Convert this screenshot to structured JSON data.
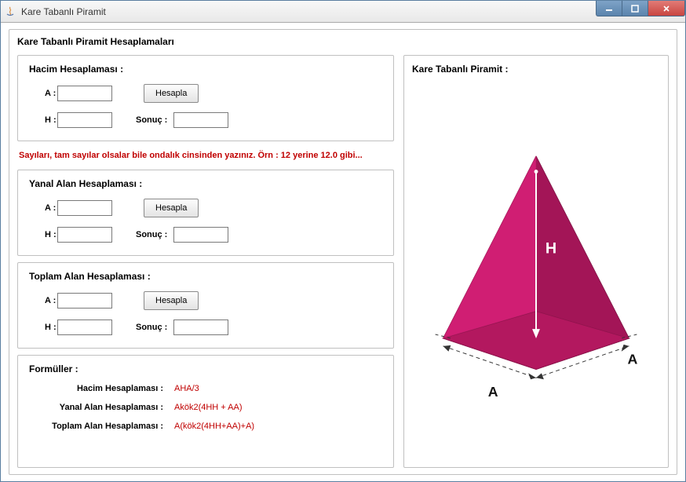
{
  "window": {
    "title": "Kare Tabanlı Piramit"
  },
  "main": {
    "header": "Kare Tabanlı Piramit Hesaplamaları"
  },
  "hacim": {
    "title": "Hacim Hesaplaması :",
    "a_label": "A :",
    "h_label": "H :",
    "button": "Hesapla",
    "sonuc_label": "Sonuç :",
    "a_value": "",
    "h_value": "",
    "sonuc_value": ""
  },
  "warning": "Sayıları, tam sayılar olsalar bile ondalık cinsinden yazınız. Örn : 12 yerine 12.0 gibi...",
  "yanal": {
    "title": "Yanal Alan Hesaplaması :",
    "a_label": "A :",
    "h_label": "H :",
    "button": "Hesapla",
    "sonuc_label": "Sonuç :",
    "a_value": "",
    "h_value": "",
    "sonuc_value": ""
  },
  "toplam": {
    "title": "Toplam Alan Hesaplaması :",
    "a_label": "A :",
    "h_label": "H :",
    "button": "Hesapla",
    "sonuc_label": "Sonuç :",
    "a_value": "",
    "h_value": "",
    "sonuc_value": ""
  },
  "formuller": {
    "title": "Formüller :",
    "hacim_label": "Hacim Hesaplaması :",
    "hacim_formula": "AHA/3",
    "yanal_label": "Yanal Alan Hesaplaması :",
    "yanal_formula": "Akök2(4HH + AA)",
    "toplam_label": "Toplam Alan Hesaplaması :",
    "toplam_formula": "A(kök2(4HH+AA)+A)"
  },
  "diagram": {
    "title": "Kare Tabanlı Piramit :",
    "h_label": "H",
    "a1_label": "A",
    "a2_label": "A"
  }
}
